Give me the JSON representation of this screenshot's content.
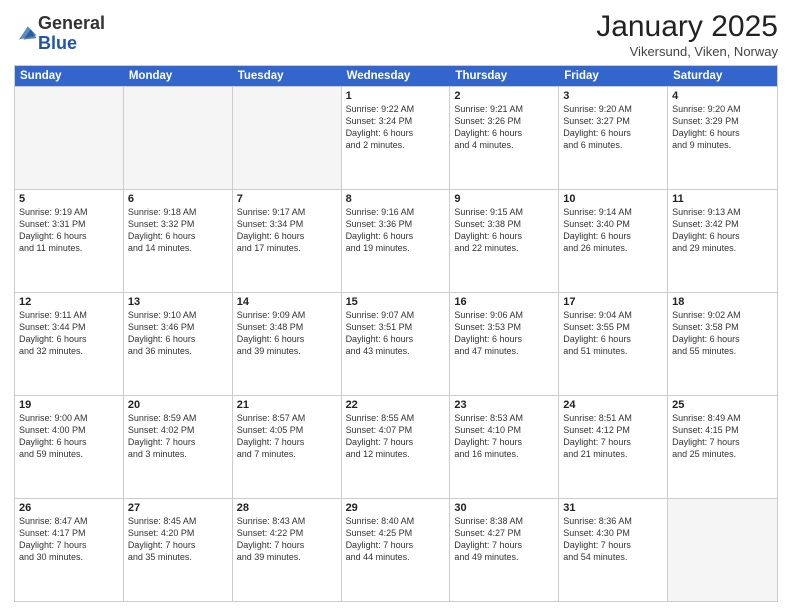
{
  "logo": {
    "general": "General",
    "blue": "Blue"
  },
  "header": {
    "month": "January 2025",
    "location": "Vikersund, Viken, Norway"
  },
  "days": [
    "Sunday",
    "Monday",
    "Tuesday",
    "Wednesday",
    "Thursday",
    "Friday",
    "Saturday"
  ],
  "weeks": [
    [
      {
        "day": "",
        "info": "",
        "empty": true
      },
      {
        "day": "",
        "info": "",
        "empty": true
      },
      {
        "day": "",
        "info": "",
        "empty": true
      },
      {
        "day": "1",
        "info": "Sunrise: 9:22 AM\nSunset: 3:24 PM\nDaylight: 6 hours\nand 2 minutes.",
        "empty": false
      },
      {
        "day": "2",
        "info": "Sunrise: 9:21 AM\nSunset: 3:26 PM\nDaylight: 6 hours\nand 4 minutes.",
        "empty": false
      },
      {
        "day": "3",
        "info": "Sunrise: 9:20 AM\nSunset: 3:27 PM\nDaylight: 6 hours\nand 6 minutes.",
        "empty": false
      },
      {
        "day": "4",
        "info": "Sunrise: 9:20 AM\nSunset: 3:29 PM\nDaylight: 6 hours\nand 9 minutes.",
        "empty": false
      }
    ],
    [
      {
        "day": "5",
        "info": "Sunrise: 9:19 AM\nSunset: 3:31 PM\nDaylight: 6 hours\nand 11 minutes.",
        "empty": false
      },
      {
        "day": "6",
        "info": "Sunrise: 9:18 AM\nSunset: 3:32 PM\nDaylight: 6 hours\nand 14 minutes.",
        "empty": false
      },
      {
        "day": "7",
        "info": "Sunrise: 9:17 AM\nSunset: 3:34 PM\nDaylight: 6 hours\nand 17 minutes.",
        "empty": false
      },
      {
        "day": "8",
        "info": "Sunrise: 9:16 AM\nSunset: 3:36 PM\nDaylight: 6 hours\nand 19 minutes.",
        "empty": false
      },
      {
        "day": "9",
        "info": "Sunrise: 9:15 AM\nSunset: 3:38 PM\nDaylight: 6 hours\nand 22 minutes.",
        "empty": false
      },
      {
        "day": "10",
        "info": "Sunrise: 9:14 AM\nSunset: 3:40 PM\nDaylight: 6 hours\nand 26 minutes.",
        "empty": false
      },
      {
        "day": "11",
        "info": "Sunrise: 9:13 AM\nSunset: 3:42 PM\nDaylight: 6 hours\nand 29 minutes.",
        "empty": false
      }
    ],
    [
      {
        "day": "12",
        "info": "Sunrise: 9:11 AM\nSunset: 3:44 PM\nDaylight: 6 hours\nand 32 minutes.",
        "empty": false
      },
      {
        "day": "13",
        "info": "Sunrise: 9:10 AM\nSunset: 3:46 PM\nDaylight: 6 hours\nand 36 minutes.",
        "empty": false
      },
      {
        "day": "14",
        "info": "Sunrise: 9:09 AM\nSunset: 3:48 PM\nDaylight: 6 hours\nand 39 minutes.",
        "empty": false
      },
      {
        "day": "15",
        "info": "Sunrise: 9:07 AM\nSunset: 3:51 PM\nDaylight: 6 hours\nand 43 minutes.",
        "empty": false
      },
      {
        "day": "16",
        "info": "Sunrise: 9:06 AM\nSunset: 3:53 PM\nDaylight: 6 hours\nand 47 minutes.",
        "empty": false
      },
      {
        "day": "17",
        "info": "Sunrise: 9:04 AM\nSunset: 3:55 PM\nDaylight: 6 hours\nand 51 minutes.",
        "empty": false
      },
      {
        "day": "18",
        "info": "Sunrise: 9:02 AM\nSunset: 3:58 PM\nDaylight: 6 hours\nand 55 minutes.",
        "empty": false
      }
    ],
    [
      {
        "day": "19",
        "info": "Sunrise: 9:00 AM\nSunset: 4:00 PM\nDaylight: 6 hours\nand 59 minutes.",
        "empty": false
      },
      {
        "day": "20",
        "info": "Sunrise: 8:59 AM\nSunset: 4:02 PM\nDaylight: 7 hours\nand 3 minutes.",
        "empty": false
      },
      {
        "day": "21",
        "info": "Sunrise: 8:57 AM\nSunset: 4:05 PM\nDaylight: 7 hours\nand 7 minutes.",
        "empty": false
      },
      {
        "day": "22",
        "info": "Sunrise: 8:55 AM\nSunset: 4:07 PM\nDaylight: 7 hours\nand 12 minutes.",
        "empty": false
      },
      {
        "day": "23",
        "info": "Sunrise: 8:53 AM\nSunset: 4:10 PM\nDaylight: 7 hours\nand 16 minutes.",
        "empty": false
      },
      {
        "day": "24",
        "info": "Sunrise: 8:51 AM\nSunset: 4:12 PM\nDaylight: 7 hours\nand 21 minutes.",
        "empty": false
      },
      {
        "day": "25",
        "info": "Sunrise: 8:49 AM\nSunset: 4:15 PM\nDaylight: 7 hours\nand 25 minutes.",
        "empty": false
      }
    ],
    [
      {
        "day": "26",
        "info": "Sunrise: 8:47 AM\nSunset: 4:17 PM\nDaylight: 7 hours\nand 30 minutes.",
        "empty": false
      },
      {
        "day": "27",
        "info": "Sunrise: 8:45 AM\nSunset: 4:20 PM\nDaylight: 7 hours\nand 35 minutes.",
        "empty": false
      },
      {
        "day": "28",
        "info": "Sunrise: 8:43 AM\nSunset: 4:22 PM\nDaylight: 7 hours\nand 39 minutes.",
        "empty": false
      },
      {
        "day": "29",
        "info": "Sunrise: 8:40 AM\nSunset: 4:25 PM\nDaylight: 7 hours\nand 44 minutes.",
        "empty": false
      },
      {
        "day": "30",
        "info": "Sunrise: 8:38 AM\nSunset: 4:27 PM\nDaylight: 7 hours\nand 49 minutes.",
        "empty": false
      },
      {
        "day": "31",
        "info": "Sunrise: 8:36 AM\nSunset: 4:30 PM\nDaylight: 7 hours\nand 54 minutes.",
        "empty": false
      },
      {
        "day": "",
        "info": "",
        "empty": true
      }
    ]
  ]
}
